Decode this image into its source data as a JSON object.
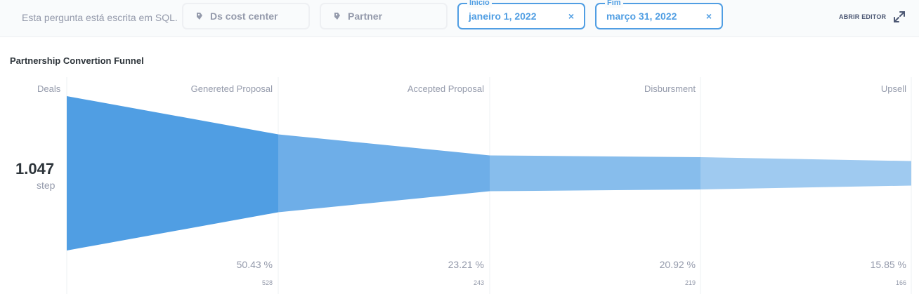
{
  "topbar": {
    "sql_note": "Esta pergunta está escrita em SQL.",
    "filters": [
      {
        "label": "Ds cost center"
      },
      {
        "label": "Partner"
      }
    ],
    "date_start": {
      "legend": "Início",
      "value": "janeiro 1, 2022",
      "clear": "×"
    },
    "date_end": {
      "legend": "Fim",
      "value": "março 31, 2022",
      "clear": "×"
    },
    "open_editor": "ABRIR EDITOR",
    "accent_color": "#509ee3"
  },
  "card": {
    "title": "Partnership Convertion Funnel"
  },
  "chart_data": {
    "type": "funnel",
    "metric_label": "Deals",
    "first_value": "1.047",
    "first_unit": "step",
    "steps": [
      {
        "name": "Generated Proposal",
        "label": "Genereted Proposal",
        "percent_text": "50.43 %",
        "count_text": "528",
        "value": 528
      },
      {
        "name": "Accepted Proposal",
        "label": "Accepted Proposal",
        "percent_text": "23.21 %",
        "count_text": "243",
        "value": 243
      },
      {
        "name": "Disbursment",
        "label": "Disbursment",
        "percent_text": "20.92 %",
        "count_text": "219",
        "value": 219
      },
      {
        "name": "Upsell",
        "label": "Upsell",
        "percent_text": "15.85 %",
        "count_text": "166",
        "value": 166
      }
    ],
    "start_value": 1047,
    "colors": [
      "#509ee3",
      "#6eaee8",
      "#87bdec",
      "#9fcaf0"
    ]
  }
}
